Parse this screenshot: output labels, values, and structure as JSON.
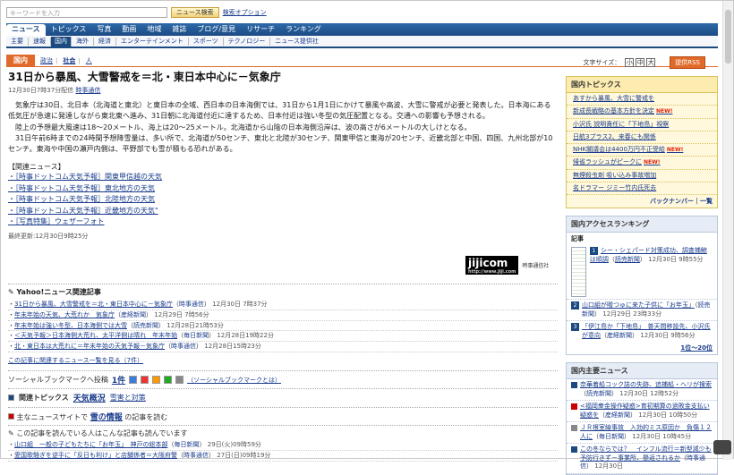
{
  "search": {
    "placeholder": "キーワードを入力",
    "button": "ニュース検索",
    "options": "検索オプション"
  },
  "nav1": [
    "ニュース",
    "トピックス",
    "写真",
    "動画",
    "地域",
    "雑誌",
    "ブログ/意見",
    "リサーチ",
    "ランキング"
  ],
  "nav2": [
    "主要",
    "速報",
    "国内",
    "海外",
    "経済",
    "エンターテインメント",
    "スポーツ",
    "テクノロジー",
    "ニュース提供社"
  ],
  "category": {
    "label": "国内",
    "subs": [
      "政治",
      "社会",
      "人"
    ],
    "font_size_label": "文字サイズ：",
    "font_sizes": [
      "小",
      "中",
      "大"
    ],
    "rss": "提供RSS"
  },
  "article": {
    "title": "31日から暴風、大雪警戒を＝北・東日本中心に－気象庁",
    "date": "12月30日7時37分配信",
    "source": "時事通信",
    "paragraphs": [
      "気象庁は30日、北日本（北海道と東北）と東日本の全域、西日本の日本海側では、31日から1月1日にかけて暴風や高波、大雪に警戒が必要と発表した。日本海にある低気圧が急速に発達しながら東北東へ進み、31日朝に北海道付近に達するため、日本付近は強い冬型の気圧配置となる。交通への影響も予想される。",
      "陸上の予想最大風速は18～20メートル、海上は20～25メートル。北海道から山陰の日本海側沿岸は、波の高さが6メートルの大しけとなる。",
      "31日午前6時までの24時間予想降雪量は、多い所で、北海道が50センチ、東北と北陸が30センチ、関東甲信と東海が20センチ、近畿北部と中国、四国、九州北部が10センチ。東海や中国の瀬戸内側は、平野部でも雪が積もる恐れがある。"
    ],
    "related_header": "【関連ニュース】",
    "related": [
      "［時事ドットコム天気予報］関東甲信越の天気",
      "［時事ドットコム天気予報］東北地方の天気",
      "［時事ドットコム天気予報］北陸地方の天気",
      "［時事ドットコム天気予報］近畿地方の天気\"",
      "［写真特集］ウェザーフォト"
    ],
    "updated": "最終更新:12月30日9時25分",
    "logo": "jijicom",
    "logo_sub": "http://www.jiji.com",
    "logo_name": "時事通信社"
  },
  "yahoo_related": {
    "header": "Yahoo!ニュース関連記事",
    "items": [
      {
        "title": "31日から暴風、大雪警戒を＝北・東日本中心に－気象庁",
        "source": "時事通信",
        "date": "12月30日 7時37分"
      },
      {
        "title": "年末年始の天気、大荒れか　気象庁",
        "source": "産経新聞",
        "date": "12月29日 7時56分"
      },
      {
        "title": "年末年始は強い冬型、日本海側では大雪",
        "source": "読売新聞",
        "date": "12月28日21時53分"
      },
      {
        "title": "＜天気予報＞日本海側大荒れ、太平洋側は晴れ　年末年始",
        "source": "毎日新聞",
        "date": "12月28日19時22分"
      },
      {
        "title": "北・東日本は大荒れに＝年末年始の天気予報－気象庁",
        "source": "時事通信",
        "date": "12月28日15時23分"
      }
    ],
    "more": "この記事に関連するニュース一覧を見る（7件）"
  },
  "social": {
    "label": "ソーシャルブックマークへ投稿",
    "count": "1件",
    "about": "（ソーシャルブックマークとは）"
  },
  "topics": {
    "label": "関連トピックス",
    "main": "天気概況",
    "sub": "雪害と対策"
  },
  "other_sites": {
    "prefix": "主なニュースサイトで",
    "link": "雪の情報",
    "suffix": "の記事を読む"
  },
  "also_read": {
    "header": "この記事を読んでいる人はこんな記事も読んでいます",
    "items": [
      {
        "title": "山口組　一般の子どもたちに「お年玉」　神戸の総本部",
        "source": "毎日新聞",
        "date": "29日(火)09時59分"
      },
      {
        "title": "愛国歌騒ぎを逆手に「反日も利け」と店舗係者＝大阪府警",
        "source": "時事通信",
        "date": "27日(日)09時19分"
      }
    ]
  },
  "sidebar": {
    "domestic_topics": {
      "header": "国内トピックス",
      "items": [
        {
          "text": "あすから暴風、大雪に警戒を",
          "new": ""
        },
        {
          "text": "新成長戦略の基本方針を決定",
          "new": "NEW!"
        },
        {
          "text": "小沢氏 説明責任に「下地島」視察",
          "new": ""
        },
        {
          "text": "日航3プラス2、来春にも関係",
          "new": ""
        },
        {
          "text": "NHK閣議会は4400万円不正受給",
          "new": "NEW!"
        },
        {
          "text": "帰省ラッシュがピークに",
          "new": "NEW!"
        },
        {
          "text": "無煙殺虫剤 吸い込み事故増加",
          "new": ""
        },
        {
          "text": "名ドラマー ジミー竹内氏死去",
          "new": ""
        }
      ],
      "footer": "バックナンバー｜一覧"
    },
    "ranking": {
      "header": "国内アクセスランキング",
      "sub": "記事",
      "top": {
        "title": "シー・シェパード対策成功、調査捕鯨は順調",
        "source": "読売新聞",
        "date": "12月30日 9時55分"
      },
      "rows": [
        {
          "num": "2",
          "title": "山口組が贈つゅに来た子供に「お年玉」",
          "source": "読売新聞",
          "date": "12月29日 23時33分"
        },
        {
          "num": "3",
          "title": "「伊江島か「下地島」　普天間移設先、小沢氏が意向",
          "source": "産経新聞",
          "date": "12月30日 9時56分"
        }
      ],
      "foot": "1位～20位"
    },
    "main_news": {
      "header": "国内主要ニュース",
      "items": [
        {
          "title": "奈華着船コック誌の失跡、追捕船・ヘリが捜索",
          "source": "読売新聞",
          "date": "12月30日 12時52分"
        },
        {
          "title": "<福岡衆金操作疑惑>育初期算の過敗金支払い疑惑を",
          "source": "産経新聞",
          "date": "12月30日 10時50分"
        },
        {
          "title": "ＪＲ根室線事故　入効的ミス原因か　負傷１２人に",
          "source": "毎日新聞",
          "date": "12月30日 10時45分"
        },
        {
          "title": "この冬ならでは？　インフル流行＝新型減少も予防行きず－事業所、懸返されるか",
          "source": "時事通信",
          "date": "12月30日"
        }
      ]
    }
  }
}
